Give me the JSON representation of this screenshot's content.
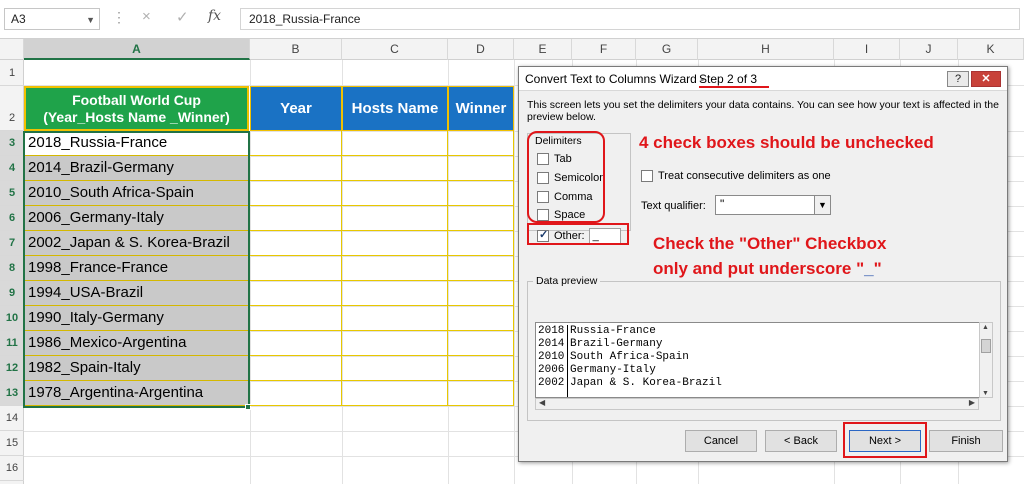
{
  "formula_bar": {
    "name_box": "A3",
    "cancel_icon": "×",
    "enter_icon": "✓",
    "fx_label": "fx",
    "content": "2018_Russia-France"
  },
  "columns": [
    "A",
    "B",
    "C",
    "D",
    "E",
    "F",
    "G",
    "H",
    "I",
    "J",
    "K"
  ],
  "rows": [
    "1",
    "2",
    "3",
    "4",
    "5",
    "6",
    "7",
    "8",
    "9",
    "10",
    "11",
    "12",
    "13",
    "14",
    "15",
    "16"
  ],
  "table": {
    "header_a_line1": "Football World Cup",
    "header_a_line2": "(Year_Hosts Name _Winner)",
    "header_b": "Year",
    "header_c": "Hosts Name",
    "header_d": "Winner",
    "values": [
      "2018_Russia-France",
      "2014_Brazil-Germany",
      "2010_South Africa-Spain",
      "2006_Germany-Italy",
      "2002_Japan & S. Korea-Brazil",
      "1998_France-France",
      "1994_USA-Brazil",
      "1990_Italy-Germany",
      "1986_Mexico-Argentina",
      "1982_Spain-Italy",
      "1978_Argentina-Argentina"
    ]
  },
  "dialog": {
    "title": "Convert Text to Columns Wizard -",
    "step": "Step 2 of 3",
    "help": "?",
    "close": "✕",
    "description": "This screen lets you set the delimiters your data contains.  You can see how your text is affected in the preview below.",
    "delimiters_label": "Delimiters",
    "tab": "Tab",
    "semicolon": "Semicolon",
    "comma": "Comma",
    "space": "Space",
    "other": "Other:",
    "other_value": "_",
    "treat_consecutive": "Treat consecutive delimiters as one",
    "text_qualifier_label": "Text qualifier:",
    "text_qualifier_value": "\"",
    "data_preview_label": "Data preview",
    "preview_rows": [
      {
        "year": "2018",
        "rest": "Russia-France"
      },
      {
        "year": "2014",
        "rest": "Brazil-Germany"
      },
      {
        "year": "2010",
        "rest": "South Africa-Spain"
      },
      {
        "year": "2006",
        "rest": "Germany-Italy"
      },
      {
        "year": "2002",
        "rest": "Japan & S. Korea-Brazil"
      }
    ],
    "buttons": {
      "cancel": "Cancel",
      "back": "< Back",
      "next": "Next >",
      "finish": "Finish"
    }
  },
  "annotations": {
    "note1": "4 check boxes should be unchecked",
    "note2_line1": "Check the \"Other\" Checkbox",
    "note2_line2_prefix": "only and put underscore \"",
    "note2_underscore": "_",
    "note2_suffix": "\""
  },
  "colors": {
    "header_green": "#1fa34a",
    "header_blue": "#1a72c4",
    "selection_green": "#217346",
    "annotation_red": "#e0161a"
  }
}
